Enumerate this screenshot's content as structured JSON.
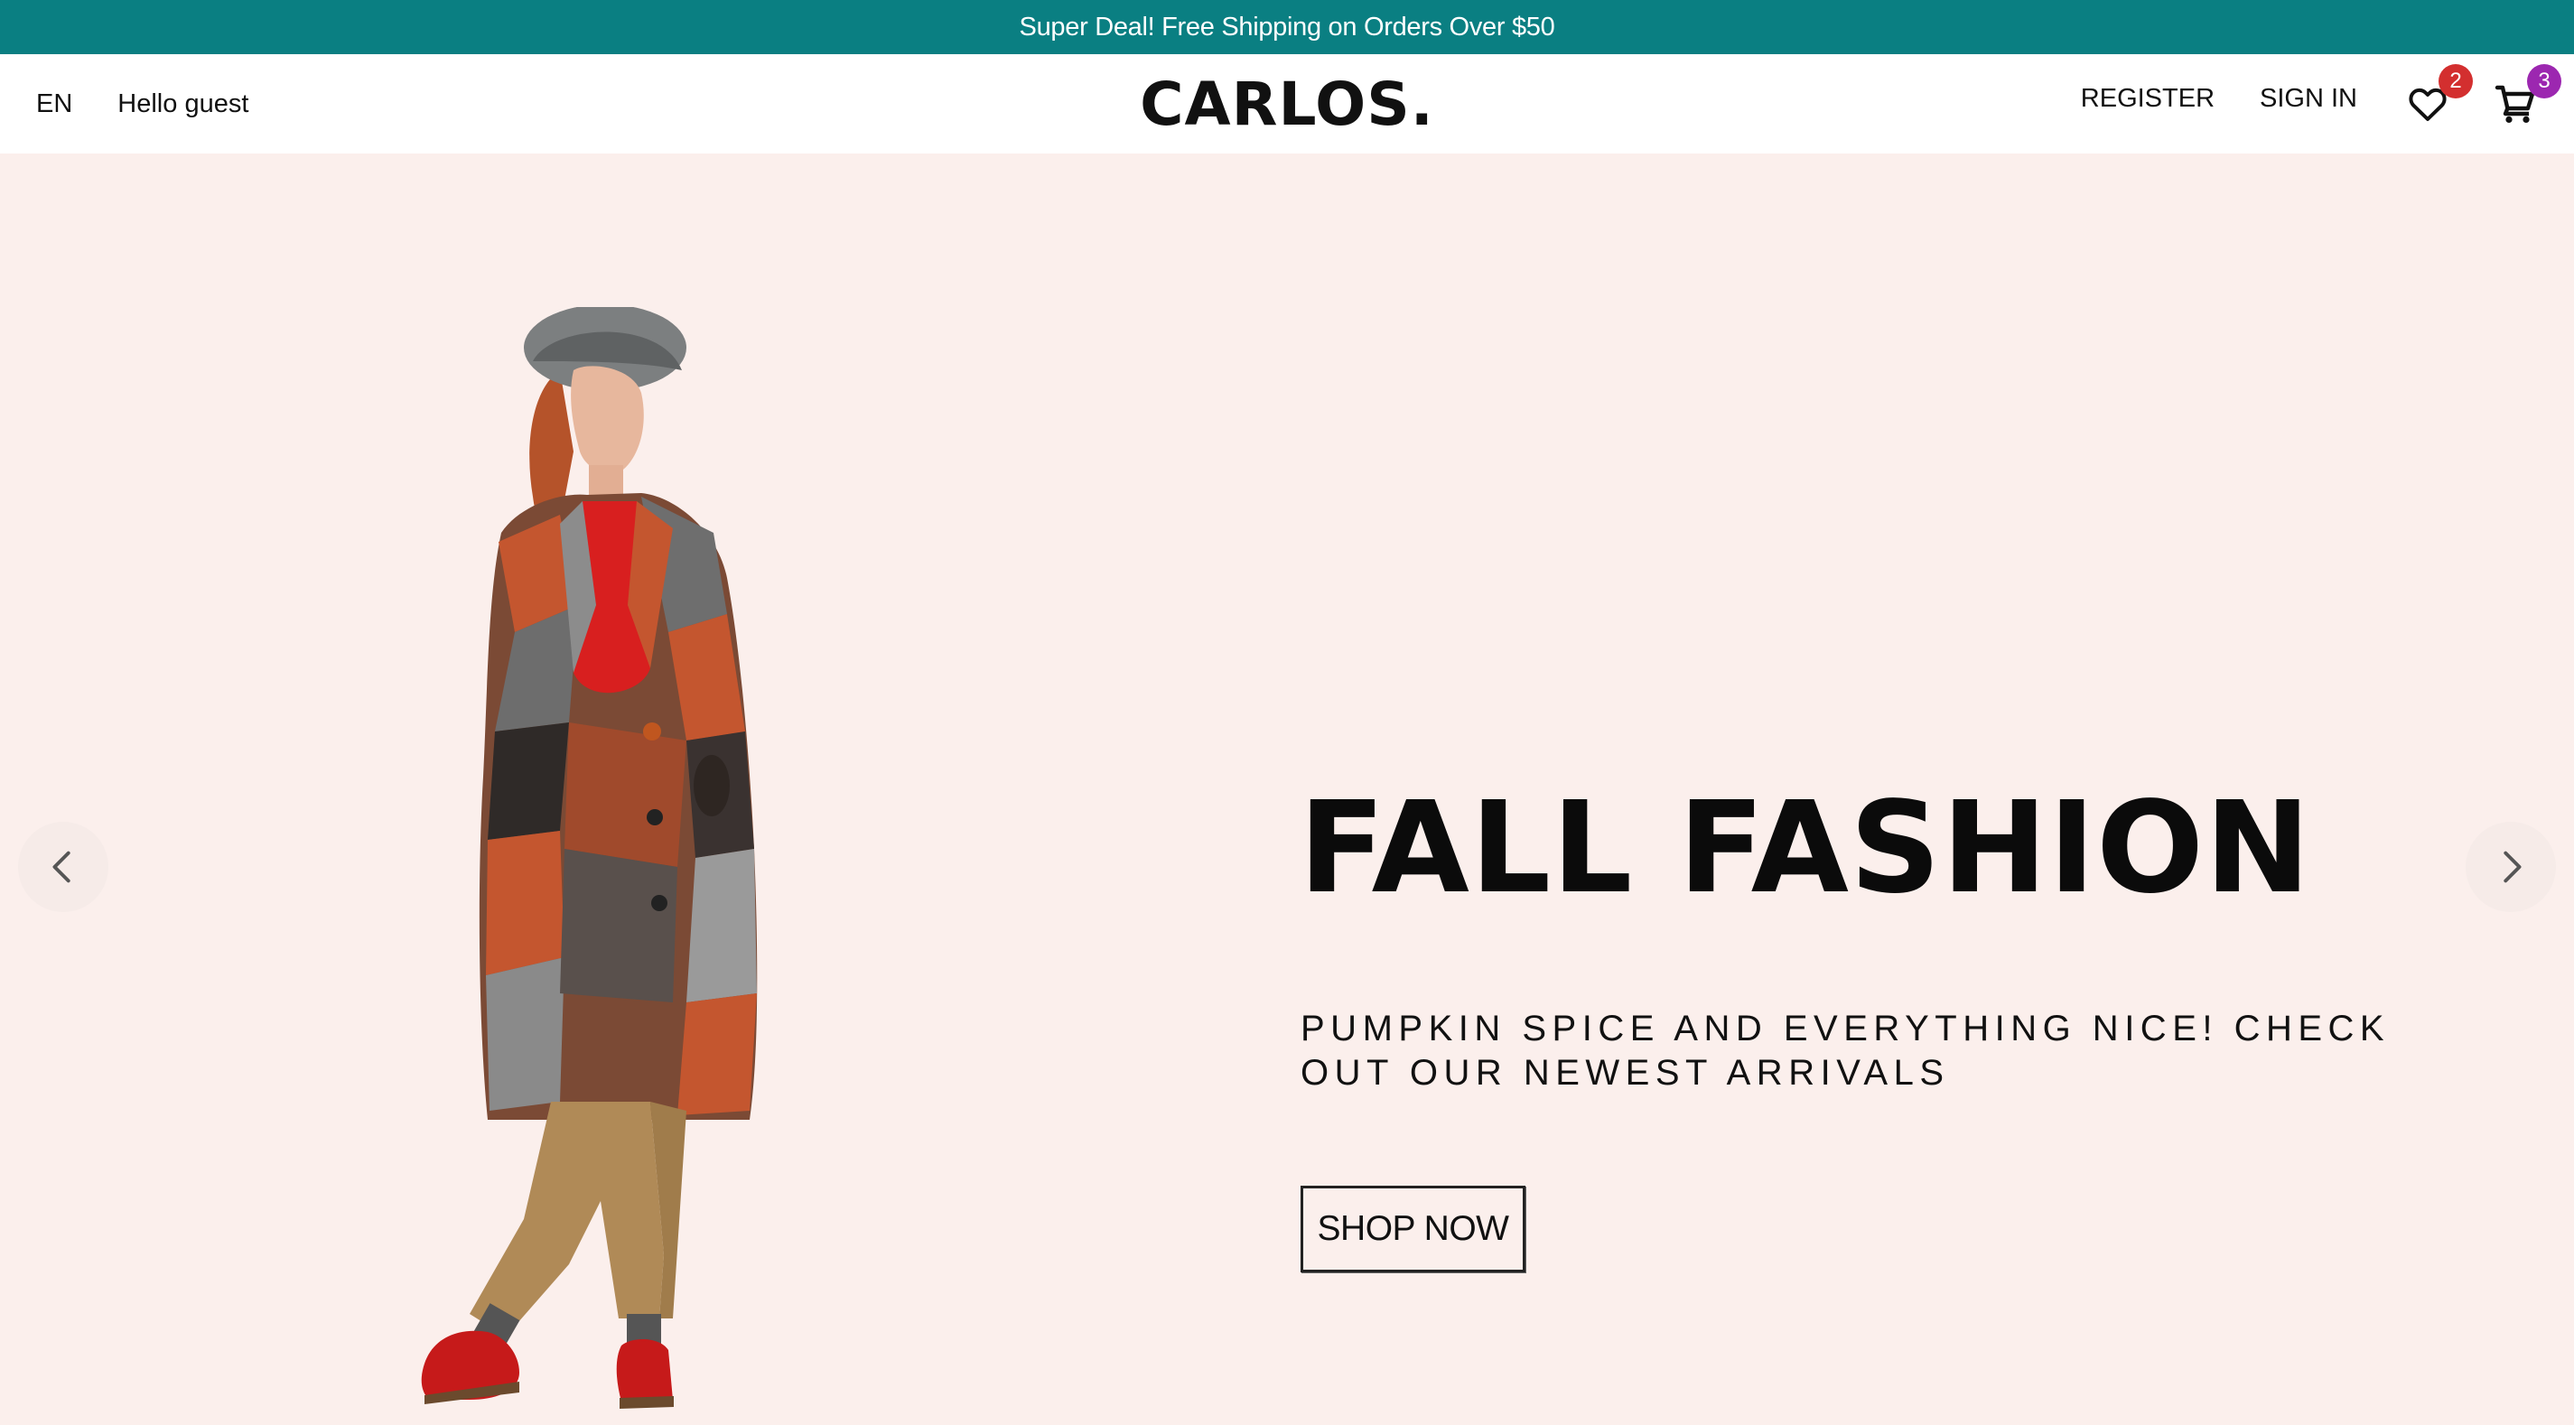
{
  "announcement": {
    "text": "Super Deal! Free Shipping on Orders Over $50",
    "background": "#0a7f82"
  },
  "navbar": {
    "language": "EN",
    "greeting": "Hello guest",
    "logo": "CARLOS.",
    "register_label": "REGISTER",
    "signin_label": "SIGN IN",
    "wishlist": {
      "icon": "heart-icon",
      "count": "2",
      "badge_color": "#d32f2f"
    },
    "cart": {
      "icon": "shopping-cart-icon",
      "count": "3",
      "badge_color": "#9c27b0"
    }
  },
  "hero": {
    "background": "#fbefec",
    "title": "FALL FASHION",
    "subtitle": "PUMPKIN SPICE AND EVERYTHING NICE! CHECK OUT OUR NEWEST ARRIVALS",
    "button_label": "SHOP NOW",
    "prev_icon": "chevron-left-icon",
    "next_icon": "chevron-right-icon",
    "image": "model-in-patchwork-coat"
  }
}
